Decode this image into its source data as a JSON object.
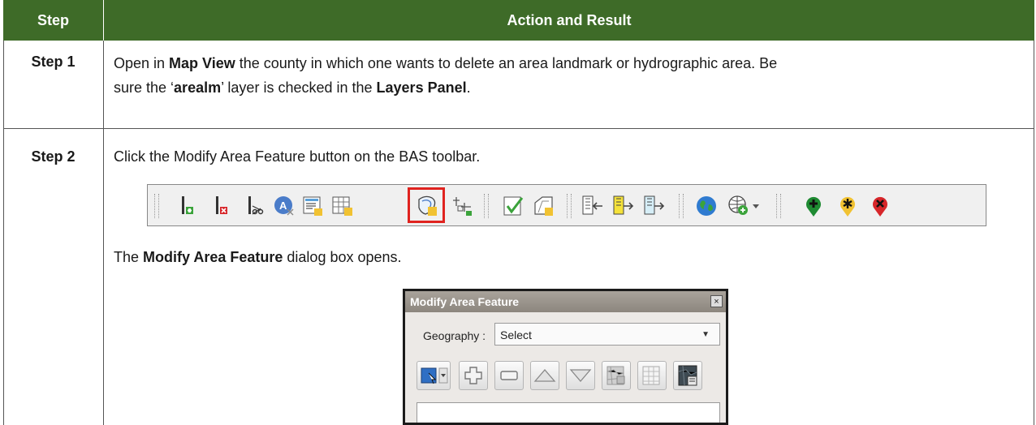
{
  "table": {
    "header": {
      "step": "Step",
      "action": "Action and Result"
    },
    "rows": [
      {
        "step": "Step 1",
        "text_parts": [
          "Open in ",
          "Map View",
          " the county in which one wants to delete an area landmark or hydrographic area. Be",
          "sure the ‘",
          "arealm",
          "’ layer is checked in the ",
          "Layers Panel",
          "."
        ]
      },
      {
        "step": "Step 2",
        "instruction": "Click the Modify Area Feature button on the BAS toolbar.",
        "result_parts": [
          "The ",
          "Modify Area Feature",
          " dialog box opens."
        ]
      }
    ]
  },
  "toolbar": {
    "highlighted_tool": "modify-area-feature",
    "highlight_color": "#e0231f",
    "tools": [
      "add-linear-feature-icon",
      "delete-linear-feature-icon",
      "split-linear-feature-icon",
      "add-area-label-icon",
      "edit-attributes-icon",
      "table-edit-icon",
      "modify-area-feature-icon",
      "boundary-tool-icon",
      "check-icon",
      "area-edit-icon",
      "import-icon",
      "export-icon",
      "export-alt-icon",
      "globe-icon",
      "globe-add-icon",
      "add-point-icon",
      "asterisk-point-icon",
      "delete-point-icon"
    ]
  },
  "dialog": {
    "title": "Modify Area Feature",
    "close_label": "×",
    "geography_label": "Geography :",
    "geography_value": "Select",
    "buttons": [
      "select-tool-icon",
      "add-icon",
      "remove-icon",
      "up-icon",
      "down-icon",
      "map-icon",
      "table-icon",
      "map-dark-icon"
    ]
  },
  "colors": {
    "header_bg": "#3e6b28",
    "header_text": "#ffffff"
  }
}
